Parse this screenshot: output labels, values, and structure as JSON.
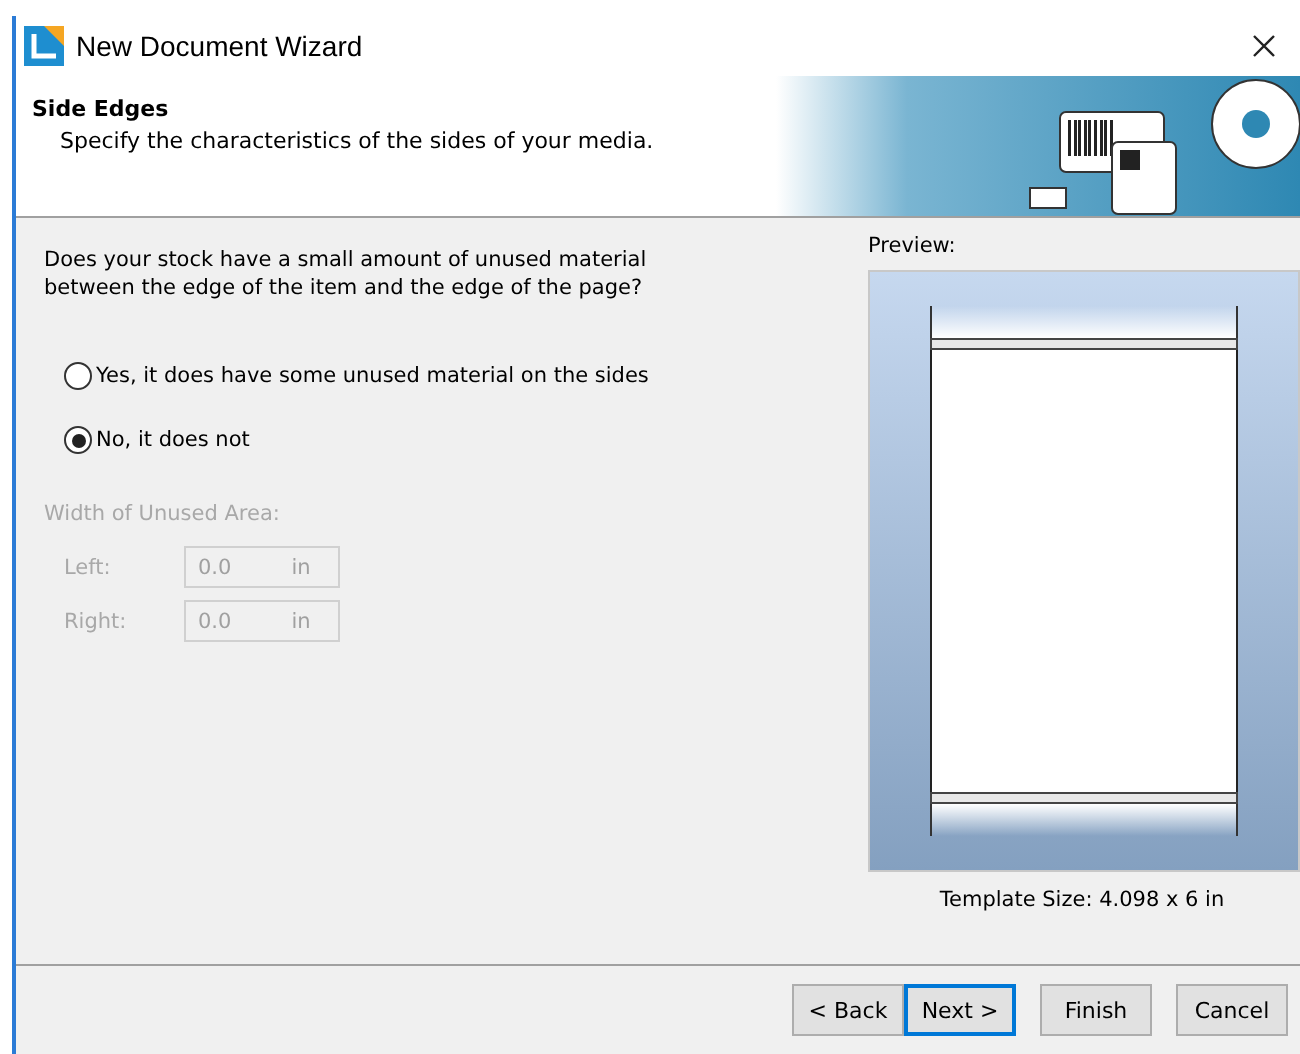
{
  "window": {
    "title": "New Document Wizard"
  },
  "header": {
    "title": "Side Edges",
    "subtitle": "Specify the characteristics of the sides of your media."
  },
  "question": "Does your stock have a small amount of unused material between the edge of the item and the edge of the page?",
  "options": [
    {
      "label": "Yes, it does have some unused material on the sides",
      "selected": false
    },
    {
      "label": "No, it does not",
      "selected": true
    }
  ],
  "unused_area": {
    "label": "Width of Unused Area:",
    "disabled": true,
    "fields": [
      {
        "label": "Left:",
        "value": "0.0",
        "unit": "in"
      },
      {
        "label": "Right:",
        "value": "0.0",
        "unit": "in"
      }
    ]
  },
  "preview": {
    "label": "Preview:",
    "template_size": "Template Size:  4.098 x 6 in"
  },
  "buttons": [
    {
      "label": "< Back",
      "focused": false
    },
    {
      "label": "Next >",
      "focused": true
    },
    {
      "label": "Finish",
      "focused": false
    },
    {
      "label": "Cancel",
      "focused": false
    }
  ]
}
